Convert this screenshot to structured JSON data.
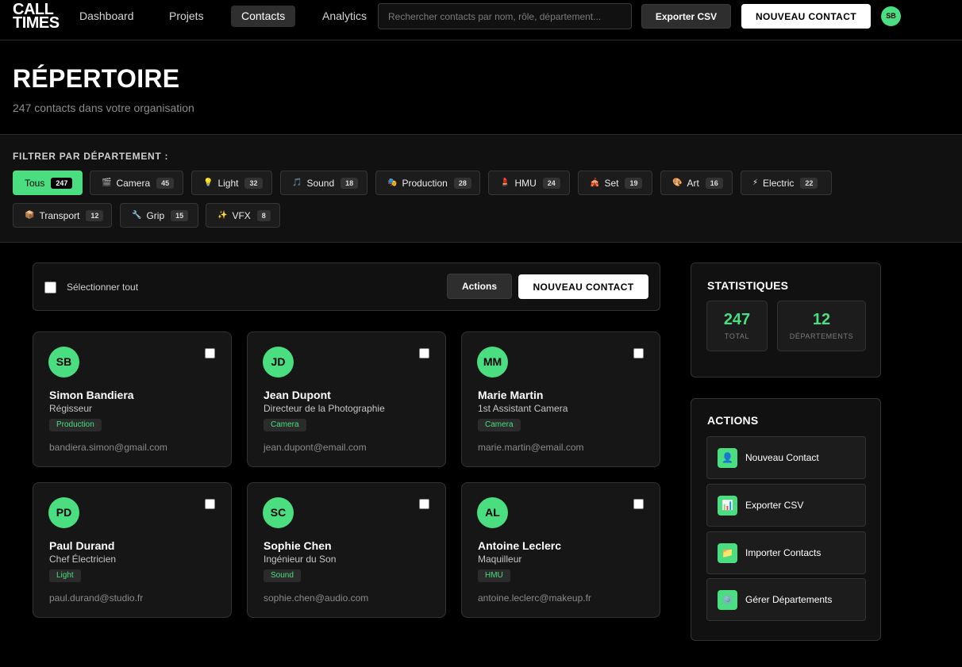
{
  "logo": {
    "line1": "CALL",
    "line2": "TIMES"
  },
  "nav": [
    {
      "label": "Dashboard"
    },
    {
      "label": "Projets"
    },
    {
      "label": "Contacts"
    },
    {
      "label": "Analytics"
    }
  ],
  "search": {
    "placeholder": "Rechercher contacts par nom, rôle, département..."
  },
  "topbar": {
    "export_label": "Exporter CSV",
    "new_label": "NOUVEAU CONTACT",
    "user_initials": "SB"
  },
  "header": {
    "title": "RÉPERTOIRE",
    "subtitle": "247 contacts dans votre organisation"
  },
  "filter": {
    "label": "FILTRER PAR DÉPARTEMENT :",
    "chips": [
      {
        "icon": "",
        "label": "Tous",
        "count": "247"
      },
      {
        "icon": "🎬",
        "label": "Camera",
        "count": "45"
      },
      {
        "icon": "💡",
        "label": "Light",
        "count": "32"
      },
      {
        "icon": "🎵",
        "label": "Sound",
        "count": "18"
      },
      {
        "icon": "🎭",
        "label": "Production",
        "count": "28"
      },
      {
        "icon": "💄",
        "label": "HMU",
        "count": "24"
      },
      {
        "icon": "🎪",
        "label": "Set",
        "count": "19"
      },
      {
        "icon": "🎨",
        "label": "Art",
        "count": "16"
      },
      {
        "icon": "⚡",
        "label": "Electric",
        "count": "22"
      },
      {
        "icon": "📦",
        "label": "Transport",
        "count": "12"
      },
      {
        "icon": "🔧",
        "label": "Grip",
        "count": "15"
      },
      {
        "icon": "✨",
        "label": "VFX",
        "count": "8"
      }
    ]
  },
  "toolbar": {
    "select_all": "Sélectionner tout",
    "actions_label": "Actions",
    "new_label": "NOUVEAU CONTACT"
  },
  "contacts": [
    {
      "initials": "SB",
      "name": "Simon Bandiera",
      "role": "Régisseur",
      "dept": "Production",
      "email": "bandiera.simon@gmail.com"
    },
    {
      "initials": "JD",
      "name": "Jean Dupont",
      "role": "Directeur de la Photographie",
      "dept": "Camera",
      "email": "jean.dupont@email.com"
    },
    {
      "initials": "MM",
      "name": "Marie Martin",
      "role": "1st Assistant Camera",
      "dept": "Camera",
      "email": "marie.martin@email.com"
    },
    {
      "initials": "PD",
      "name": "Paul Durand",
      "role": "Chef Électricien",
      "dept": "Light",
      "email": "paul.durand@studio.fr"
    },
    {
      "initials": "SC",
      "name": "Sophie Chen",
      "role": "Ingénieur du Son",
      "dept": "Sound",
      "email": "sophie.chen@audio.com"
    },
    {
      "initials": "AL",
      "name": "Antoine Leclerc",
      "role": "Maquilleur",
      "dept": "HMU",
      "email": "antoine.leclerc@makeup.fr"
    }
  ],
  "stats": {
    "title": "STATISTIQUES",
    "items": [
      {
        "value": "247",
        "label": "TOTAL"
      },
      {
        "value": "12",
        "label": "DÉPARTEMENTS"
      }
    ]
  },
  "actions": {
    "title": "ACTIONS",
    "items": [
      {
        "icon": "👤",
        "label": "Nouveau Contact"
      },
      {
        "icon": "📊",
        "label": "Exporter CSV"
      },
      {
        "icon": "📁",
        "label": "Importer Contacts"
      },
      {
        "icon": "⚙️",
        "label": "Gérer Départements"
      }
    ]
  },
  "colors": {
    "accent": "#4ade80",
    "background": "#000000",
    "surface": "#111111"
  }
}
